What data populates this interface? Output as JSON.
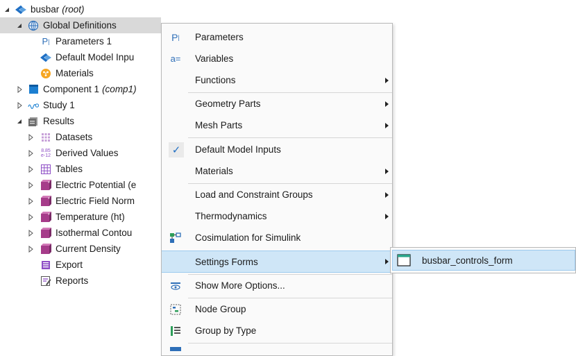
{
  "tree": {
    "root": {
      "label": "busbar",
      "suffix": "(root)"
    },
    "global_definitions": "Global Definitions",
    "parameters": "Parameters 1",
    "default_model_inputs": "Default Model Inpu",
    "materials": "Materials",
    "component": {
      "label": "Component 1",
      "suffix": "(comp1)"
    },
    "study": "Study 1",
    "results": "Results",
    "datasets": "Datasets",
    "derived_values": "Derived Values",
    "derived_icon_text": {
      "top": "8.85",
      "bottom": "e-12"
    },
    "tables": "Tables",
    "electric_potential": "Electric Potential (e",
    "electric_field": "Electric Field Norm",
    "temperature": "Temperature (ht)",
    "isothermal": "Isothermal Contou",
    "current_density": "Current Density",
    "export": "Export",
    "reports": "Reports"
  },
  "menu": {
    "items": [
      {
        "label": "Parameters",
        "icon": "parameters-icon",
        "icon_text": "P",
        "submenu": false
      },
      {
        "label": "Variables",
        "icon": "variables-icon",
        "icon_text": "a=",
        "submenu": false
      },
      {
        "label": "Functions",
        "icon": "",
        "submenu": true
      },
      {
        "label": "Geometry Parts",
        "icon": "",
        "submenu": true
      },
      {
        "label": "Mesh Parts",
        "icon": "",
        "submenu": true
      },
      {
        "label": "Default Model Inputs",
        "icon": "check-icon",
        "icon_text": "✓",
        "submenu": false
      },
      {
        "label": "Materials",
        "icon": "",
        "submenu": true
      },
      {
        "label": "Load and Constraint Groups",
        "icon": "",
        "submenu": true
      },
      {
        "label": "Thermodynamics",
        "icon": "",
        "submenu": true
      },
      {
        "label": "Cosimulation for Simulink",
        "icon": "cosimulation-icon",
        "submenu": false
      },
      {
        "label": "Settings Forms",
        "icon": "",
        "submenu": true
      },
      {
        "label": "Show More Options...",
        "icon": "eye-icon",
        "submenu": false
      },
      {
        "label": "Node Group",
        "icon": "node-group-icon",
        "submenu": false
      },
      {
        "label": "Group by Type",
        "icon": "group-by-type-icon",
        "submenu": false
      }
    ]
  },
  "submenu": {
    "item": "busbar_controls_form"
  },
  "colors": {
    "highlight": "#cfe6f7",
    "highlight_border": "#9ccaee",
    "selected_row": "#d9d9d9",
    "accent_blue": "#1f6fc4"
  }
}
